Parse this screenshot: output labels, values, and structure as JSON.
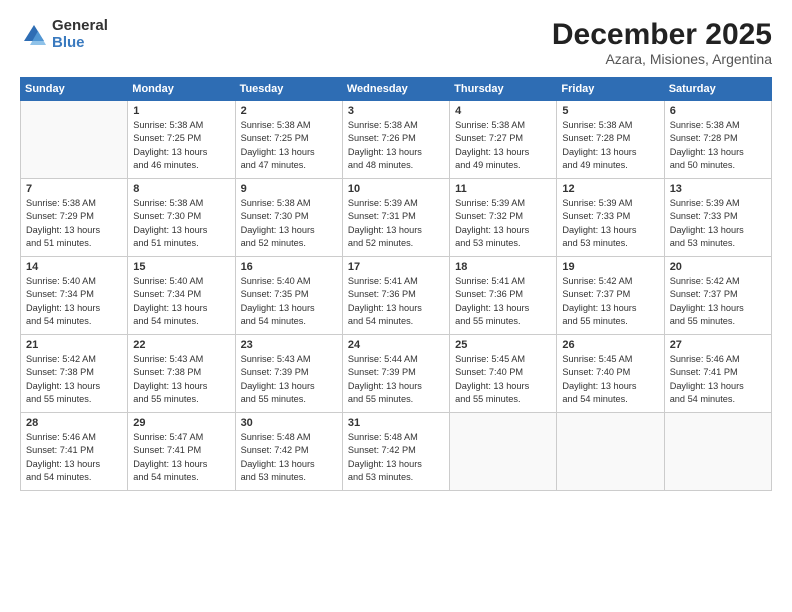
{
  "header": {
    "logo_general": "General",
    "logo_blue": "Blue",
    "month": "December 2025",
    "location": "Azara, Misiones, Argentina"
  },
  "days_of_week": [
    "Sunday",
    "Monday",
    "Tuesday",
    "Wednesday",
    "Thursday",
    "Friday",
    "Saturday"
  ],
  "weeks": [
    [
      {
        "day": "",
        "empty": true
      },
      {
        "day": "1",
        "sunrise": "Sunrise: 5:38 AM",
        "sunset": "Sunset: 7:25 PM",
        "daylight": "Daylight: 13 hours and 46 minutes."
      },
      {
        "day": "2",
        "sunrise": "Sunrise: 5:38 AM",
        "sunset": "Sunset: 7:25 PM",
        "daylight": "Daylight: 13 hours and 47 minutes."
      },
      {
        "day": "3",
        "sunrise": "Sunrise: 5:38 AM",
        "sunset": "Sunset: 7:26 PM",
        "daylight": "Daylight: 13 hours and 48 minutes."
      },
      {
        "day": "4",
        "sunrise": "Sunrise: 5:38 AM",
        "sunset": "Sunset: 7:27 PM",
        "daylight": "Daylight: 13 hours and 49 minutes."
      },
      {
        "day": "5",
        "sunrise": "Sunrise: 5:38 AM",
        "sunset": "Sunset: 7:28 PM",
        "daylight": "Daylight: 13 hours and 49 minutes."
      },
      {
        "day": "6",
        "sunrise": "Sunrise: 5:38 AM",
        "sunset": "Sunset: 7:28 PM",
        "daylight": "Daylight: 13 hours and 50 minutes."
      }
    ],
    [
      {
        "day": "7",
        "sunrise": "Sunrise: 5:38 AM",
        "sunset": "Sunset: 7:29 PM",
        "daylight": "Daylight: 13 hours and 51 minutes."
      },
      {
        "day": "8",
        "sunrise": "Sunrise: 5:38 AM",
        "sunset": "Sunset: 7:30 PM",
        "daylight": "Daylight: 13 hours and 51 minutes."
      },
      {
        "day": "9",
        "sunrise": "Sunrise: 5:38 AM",
        "sunset": "Sunset: 7:30 PM",
        "daylight": "Daylight: 13 hours and 52 minutes."
      },
      {
        "day": "10",
        "sunrise": "Sunrise: 5:39 AM",
        "sunset": "Sunset: 7:31 PM",
        "daylight": "Daylight: 13 hours and 52 minutes."
      },
      {
        "day": "11",
        "sunrise": "Sunrise: 5:39 AM",
        "sunset": "Sunset: 7:32 PM",
        "daylight": "Daylight: 13 hours and 53 minutes."
      },
      {
        "day": "12",
        "sunrise": "Sunrise: 5:39 AM",
        "sunset": "Sunset: 7:33 PM",
        "daylight": "Daylight: 13 hours and 53 minutes."
      },
      {
        "day": "13",
        "sunrise": "Sunrise: 5:39 AM",
        "sunset": "Sunset: 7:33 PM",
        "daylight": "Daylight: 13 hours and 53 minutes."
      }
    ],
    [
      {
        "day": "14",
        "sunrise": "Sunrise: 5:40 AM",
        "sunset": "Sunset: 7:34 PM",
        "daylight": "Daylight: 13 hours and 54 minutes."
      },
      {
        "day": "15",
        "sunrise": "Sunrise: 5:40 AM",
        "sunset": "Sunset: 7:34 PM",
        "daylight": "Daylight: 13 hours and 54 minutes."
      },
      {
        "day": "16",
        "sunrise": "Sunrise: 5:40 AM",
        "sunset": "Sunset: 7:35 PM",
        "daylight": "Daylight: 13 hours and 54 minutes."
      },
      {
        "day": "17",
        "sunrise": "Sunrise: 5:41 AM",
        "sunset": "Sunset: 7:36 PM",
        "daylight": "Daylight: 13 hours and 54 minutes."
      },
      {
        "day": "18",
        "sunrise": "Sunrise: 5:41 AM",
        "sunset": "Sunset: 7:36 PM",
        "daylight": "Daylight: 13 hours and 55 minutes."
      },
      {
        "day": "19",
        "sunrise": "Sunrise: 5:42 AM",
        "sunset": "Sunset: 7:37 PM",
        "daylight": "Daylight: 13 hours and 55 minutes."
      },
      {
        "day": "20",
        "sunrise": "Sunrise: 5:42 AM",
        "sunset": "Sunset: 7:37 PM",
        "daylight": "Daylight: 13 hours and 55 minutes."
      }
    ],
    [
      {
        "day": "21",
        "sunrise": "Sunrise: 5:42 AM",
        "sunset": "Sunset: 7:38 PM",
        "daylight": "Daylight: 13 hours and 55 minutes."
      },
      {
        "day": "22",
        "sunrise": "Sunrise: 5:43 AM",
        "sunset": "Sunset: 7:38 PM",
        "daylight": "Daylight: 13 hours and 55 minutes."
      },
      {
        "day": "23",
        "sunrise": "Sunrise: 5:43 AM",
        "sunset": "Sunset: 7:39 PM",
        "daylight": "Daylight: 13 hours and 55 minutes."
      },
      {
        "day": "24",
        "sunrise": "Sunrise: 5:44 AM",
        "sunset": "Sunset: 7:39 PM",
        "daylight": "Daylight: 13 hours and 55 minutes."
      },
      {
        "day": "25",
        "sunrise": "Sunrise: 5:45 AM",
        "sunset": "Sunset: 7:40 PM",
        "daylight": "Daylight: 13 hours and 55 minutes."
      },
      {
        "day": "26",
        "sunrise": "Sunrise: 5:45 AM",
        "sunset": "Sunset: 7:40 PM",
        "daylight": "Daylight: 13 hours and 54 minutes."
      },
      {
        "day": "27",
        "sunrise": "Sunrise: 5:46 AM",
        "sunset": "Sunset: 7:41 PM",
        "daylight": "Daylight: 13 hours and 54 minutes."
      }
    ],
    [
      {
        "day": "28",
        "sunrise": "Sunrise: 5:46 AM",
        "sunset": "Sunset: 7:41 PM",
        "daylight": "Daylight: 13 hours and 54 minutes."
      },
      {
        "day": "29",
        "sunrise": "Sunrise: 5:47 AM",
        "sunset": "Sunset: 7:41 PM",
        "daylight": "Daylight: 13 hours and 54 minutes."
      },
      {
        "day": "30",
        "sunrise": "Sunrise: 5:48 AM",
        "sunset": "Sunset: 7:42 PM",
        "daylight": "Daylight: 13 hours and 53 minutes."
      },
      {
        "day": "31",
        "sunrise": "Sunrise: 5:48 AM",
        "sunset": "Sunset: 7:42 PM",
        "daylight": "Daylight: 13 hours and 53 minutes."
      },
      {
        "day": "",
        "empty": true
      },
      {
        "day": "",
        "empty": true
      },
      {
        "day": "",
        "empty": true
      }
    ]
  ]
}
